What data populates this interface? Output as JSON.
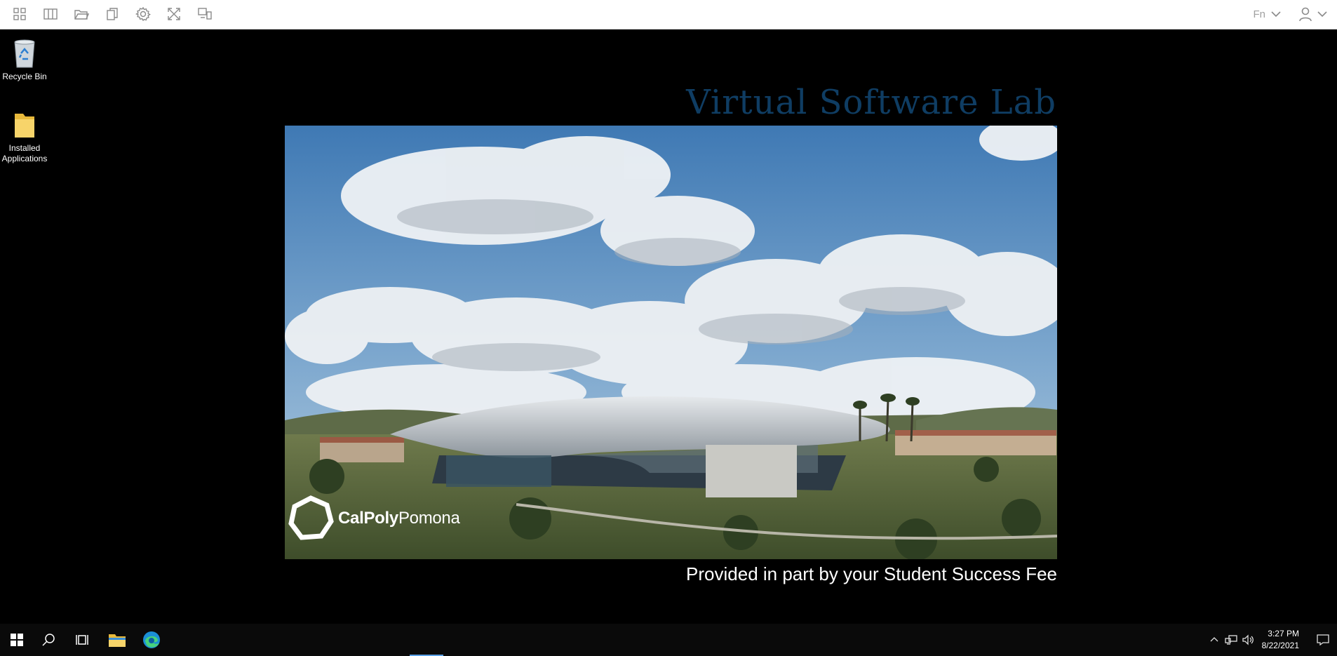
{
  "toolbar": {
    "buttons": [
      "apps-icon",
      "panel-icon",
      "folder-icon",
      "clipboard-icon",
      "settings-icon",
      "fullscreen-icon",
      "display-icon"
    ],
    "language": "Fn"
  },
  "desktop": {
    "icons": [
      {
        "label": "Recycle Bin",
        "icon": "recycle-bin-icon"
      },
      {
        "label": "Installed Applications",
        "icon": "folder-icon"
      }
    ]
  },
  "wallpaper": {
    "title": "Virtual Software Lab",
    "brand_bold": "CalPoly",
    "brand_light": "Pomona",
    "footer": "Provided in part by your Student Success Fee"
  },
  "taskbar": {
    "apps": [
      "windows-start-icon",
      "search-icon",
      "task-view-icon",
      "file-explorer-icon",
      "edge-icon"
    ],
    "time": "3:27 PM",
    "date": "8/22/2021"
  },
  "colors": {
    "title": "#0f3d63",
    "toolbar_bg": "#ffffff",
    "taskbar_bg": "#0a0a0a"
  }
}
